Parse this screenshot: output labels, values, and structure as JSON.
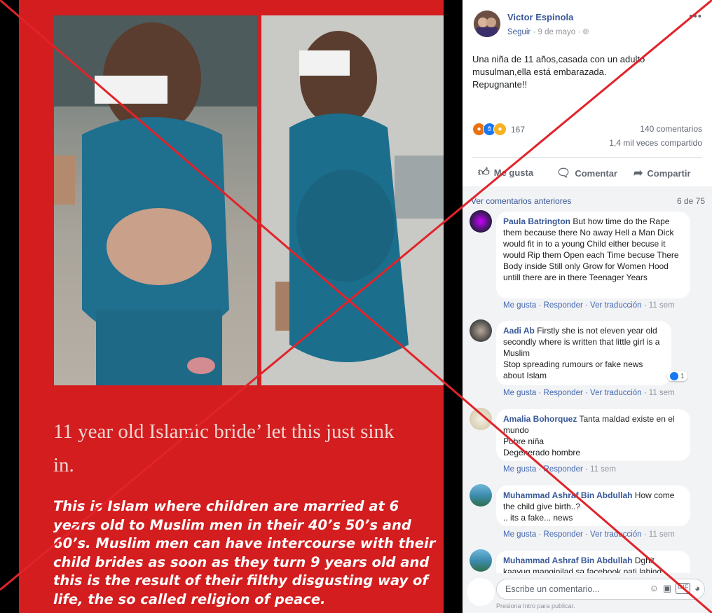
{
  "poster": {
    "caption": "11 year old Islamic bride’ let this just sink in.",
    "body": "This is Islam where children are married at 6 years old to Muslim men in their 40’s 50’s and 60’s. Muslim men can have intercourse with their child brides as soon as they turn 9 years old and this is the result of their filthy disgusting way of life, the so called religion of peace."
  },
  "post": {
    "author": "Victor Espinola",
    "follow": "Seguir",
    "date": "· 9 de mayo ·",
    "more": "•••",
    "text_lines": [
      "Una niña de 11 años,casada con un adulto",
      "musulman,ella está embarazada.",
      "Repugnante!!"
    ],
    "reaction_count": "167",
    "comments_count": "140 comentarios",
    "shares_count": "1,4 mil veces compartido",
    "actions": {
      "like": "Me gusta",
      "comment": "Comentar",
      "share": "Compartir"
    }
  },
  "comments_header": {
    "previous": "Ver comentarios anteriores",
    "count": "6 de 75"
  },
  "comments": [
    {
      "name": "Paula Batrington",
      "text": "But how time do the Rape them because there No away Hell a Man Dick would fit in to a young Child either becuse it would Rip them Open each Time becuse There Body inside Still only Grow for Women Hood untill there are in there Teenager Years",
      "like": "Me gusta",
      "reply": "Responder",
      "translate": "Ver traducción",
      "time": "11 sem"
    },
    {
      "name": "Aadi Ab",
      "text": "Firstly she is not eleven year old secondly where is written that little girl is a Muslim\nStop spreading rumours or fake news about Islam",
      "like": "Me gusta",
      "reply": "Responder",
      "translate": "Ver traducción",
      "time": "11 sem",
      "reactions": "1"
    },
    {
      "name": "Amalia Bohorquez",
      "text": "Tanta maldad existe en el mundo\nPobre niña\nDegenerado hombre",
      "like": "Me gusta",
      "reply": "Responder",
      "time": "11 sem"
    },
    {
      "name": "Muhammad Ashraf Bin Abdullah",
      "text": "How come the child give birth..?\n.. its a fake... news",
      "like": "Me gusta",
      "reply": "Responder",
      "translate": "Ver traducción",
      "time": "11 sem"
    },
    {
      "name": "Muhammad Ashraf Bin Abdullah",
      "text": "Dghit kaayug manginilad sa facebook pati lahing"
    }
  ],
  "composer": {
    "placeholder": "Escribe un comentario...",
    "hint": "Presiona Intro para publicar."
  },
  "colors": {
    "cross": "#e2232a",
    "poster_red": "#d31d1f",
    "link_blue": "#385898"
  }
}
